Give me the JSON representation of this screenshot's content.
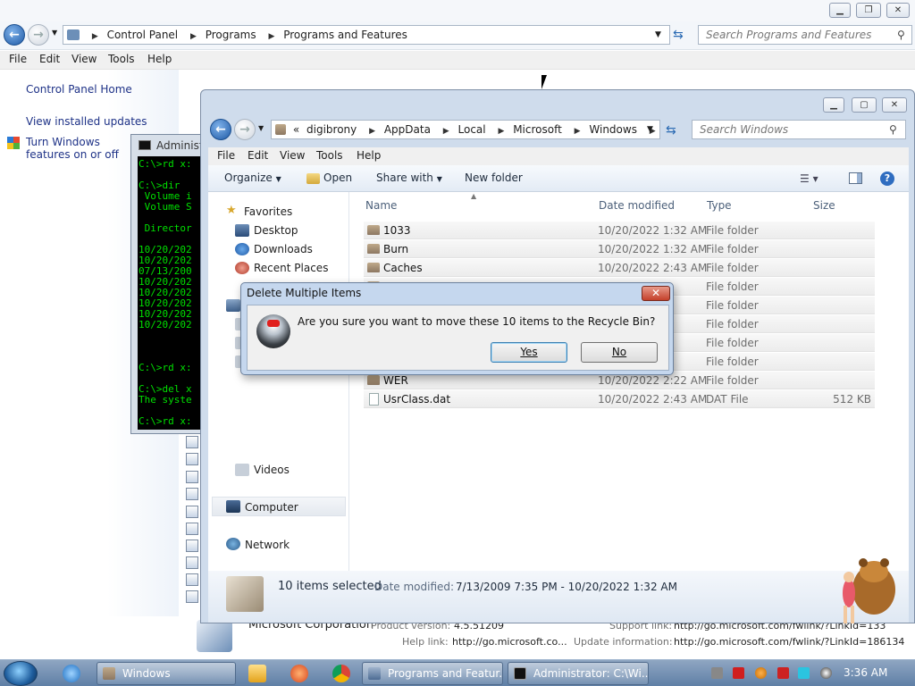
{
  "cp": {
    "breadcrumb": [
      "Control Panel",
      "Programs",
      "Programs and Features"
    ],
    "search_placeholder": "Search Programs and Features",
    "menu": [
      "File",
      "Edit",
      "View",
      "Tools",
      "Help"
    ],
    "left_links": [
      "Control Panel Home",
      "View installed updates",
      "Turn Windows features on or off"
    ],
    "publisher": "Microsoft Corporation",
    "product_version_label": "Product version:",
    "product_version": "4.5.51209",
    "support_link_label": "Support link:",
    "support_link": "http://go.microsoft.com/fwlink/?LinkId=133",
    "help_link_label": "Help link:",
    "help_link": "http://go.microsoft.co...",
    "update_info_label": "Update information:",
    "update_info": "http://go.microsoft.com/fwlink/?LinkId=186134"
  },
  "console": {
    "title": "Administrator: C:\\Windows\\system32\\cmd.exe",
    "lines": [
      "C:\\>rd x:",
      "",
      "C:\\>dir",
      " Volume i",
      " Volume S",
      "",
      " Director",
      "",
      "10/20/202",
      "10/20/202",
      "07/13/200",
      "10/20/202",
      "10/20/202",
      "10/20/202",
      "10/20/202",
      "10/20/202",
      "",
      "",
      "",
      "C:\\>rd x:",
      "",
      "C:\\>del x",
      "The syste",
      "",
      "C:\\>rd x:"
    ]
  },
  "explorer": {
    "breadcrumb": [
      "digibrony",
      "AppData",
      "Local",
      "Microsoft",
      "Windows"
    ],
    "overflow": "«",
    "search_placeholder": "Search Windows",
    "menu": [
      "File",
      "Edit",
      "View",
      "Tools",
      "Help"
    ],
    "toolbar": {
      "organize": "Organize",
      "open": "Open",
      "share_with": "Share with",
      "new_folder": "New folder"
    },
    "nav": {
      "favorites": "Favorites",
      "desktop": "Desktop",
      "downloads": "Downloads",
      "recent_places": "Recent Places",
      "videos": "Videos",
      "computer": "Computer",
      "network": "Network"
    },
    "columns": {
      "name": "Name",
      "date": "Date modified",
      "type": "Type",
      "size": "Size"
    },
    "rows": [
      {
        "name": "1033",
        "date": "10/20/2022 1:32 AM",
        "type": "File folder",
        "size": ""
      },
      {
        "name": "Burn",
        "date": "10/20/2022 1:32 AM",
        "type": "File folder",
        "size": ""
      },
      {
        "name": "Caches",
        "date": "10/20/2022 2:43 AM",
        "type": "File folder",
        "size": ""
      },
      {
        "name": "",
        "date": "M",
        "type": "File folder",
        "size": ""
      },
      {
        "name": "",
        "date": "M",
        "type": "File folder",
        "size": ""
      },
      {
        "name": "",
        "date": "M",
        "type": "File folder",
        "size": ""
      },
      {
        "name": "",
        "date": "M",
        "type": "File folder",
        "size": ""
      },
      {
        "name": "",
        "date": "M",
        "type": "File folder",
        "size": ""
      },
      {
        "name": "WER",
        "date": "10/20/2022 2:22 AM",
        "type": "File folder",
        "size": ""
      },
      {
        "name": "UsrClass.dat",
        "date": "10/20/2022 2:43 AM",
        "type": "DAT File",
        "size": "512 KB"
      }
    ],
    "status": {
      "selected": "10 items selected",
      "date_label": "Date modified:",
      "date_range": "7/13/2009 7:35 PM - 10/20/2022 1:32 AM"
    }
  },
  "dialog": {
    "title": "Delete Multiple Items",
    "message": "Are you sure you want to move these 10 items to the Recycle Bin?",
    "yes": "Yes",
    "no": "No"
  },
  "taskbar": {
    "tasks": [
      "Windows",
      "Programs and Featur...",
      "Administrator: C:\\Wi..."
    ],
    "clock": "3:36 AM"
  }
}
